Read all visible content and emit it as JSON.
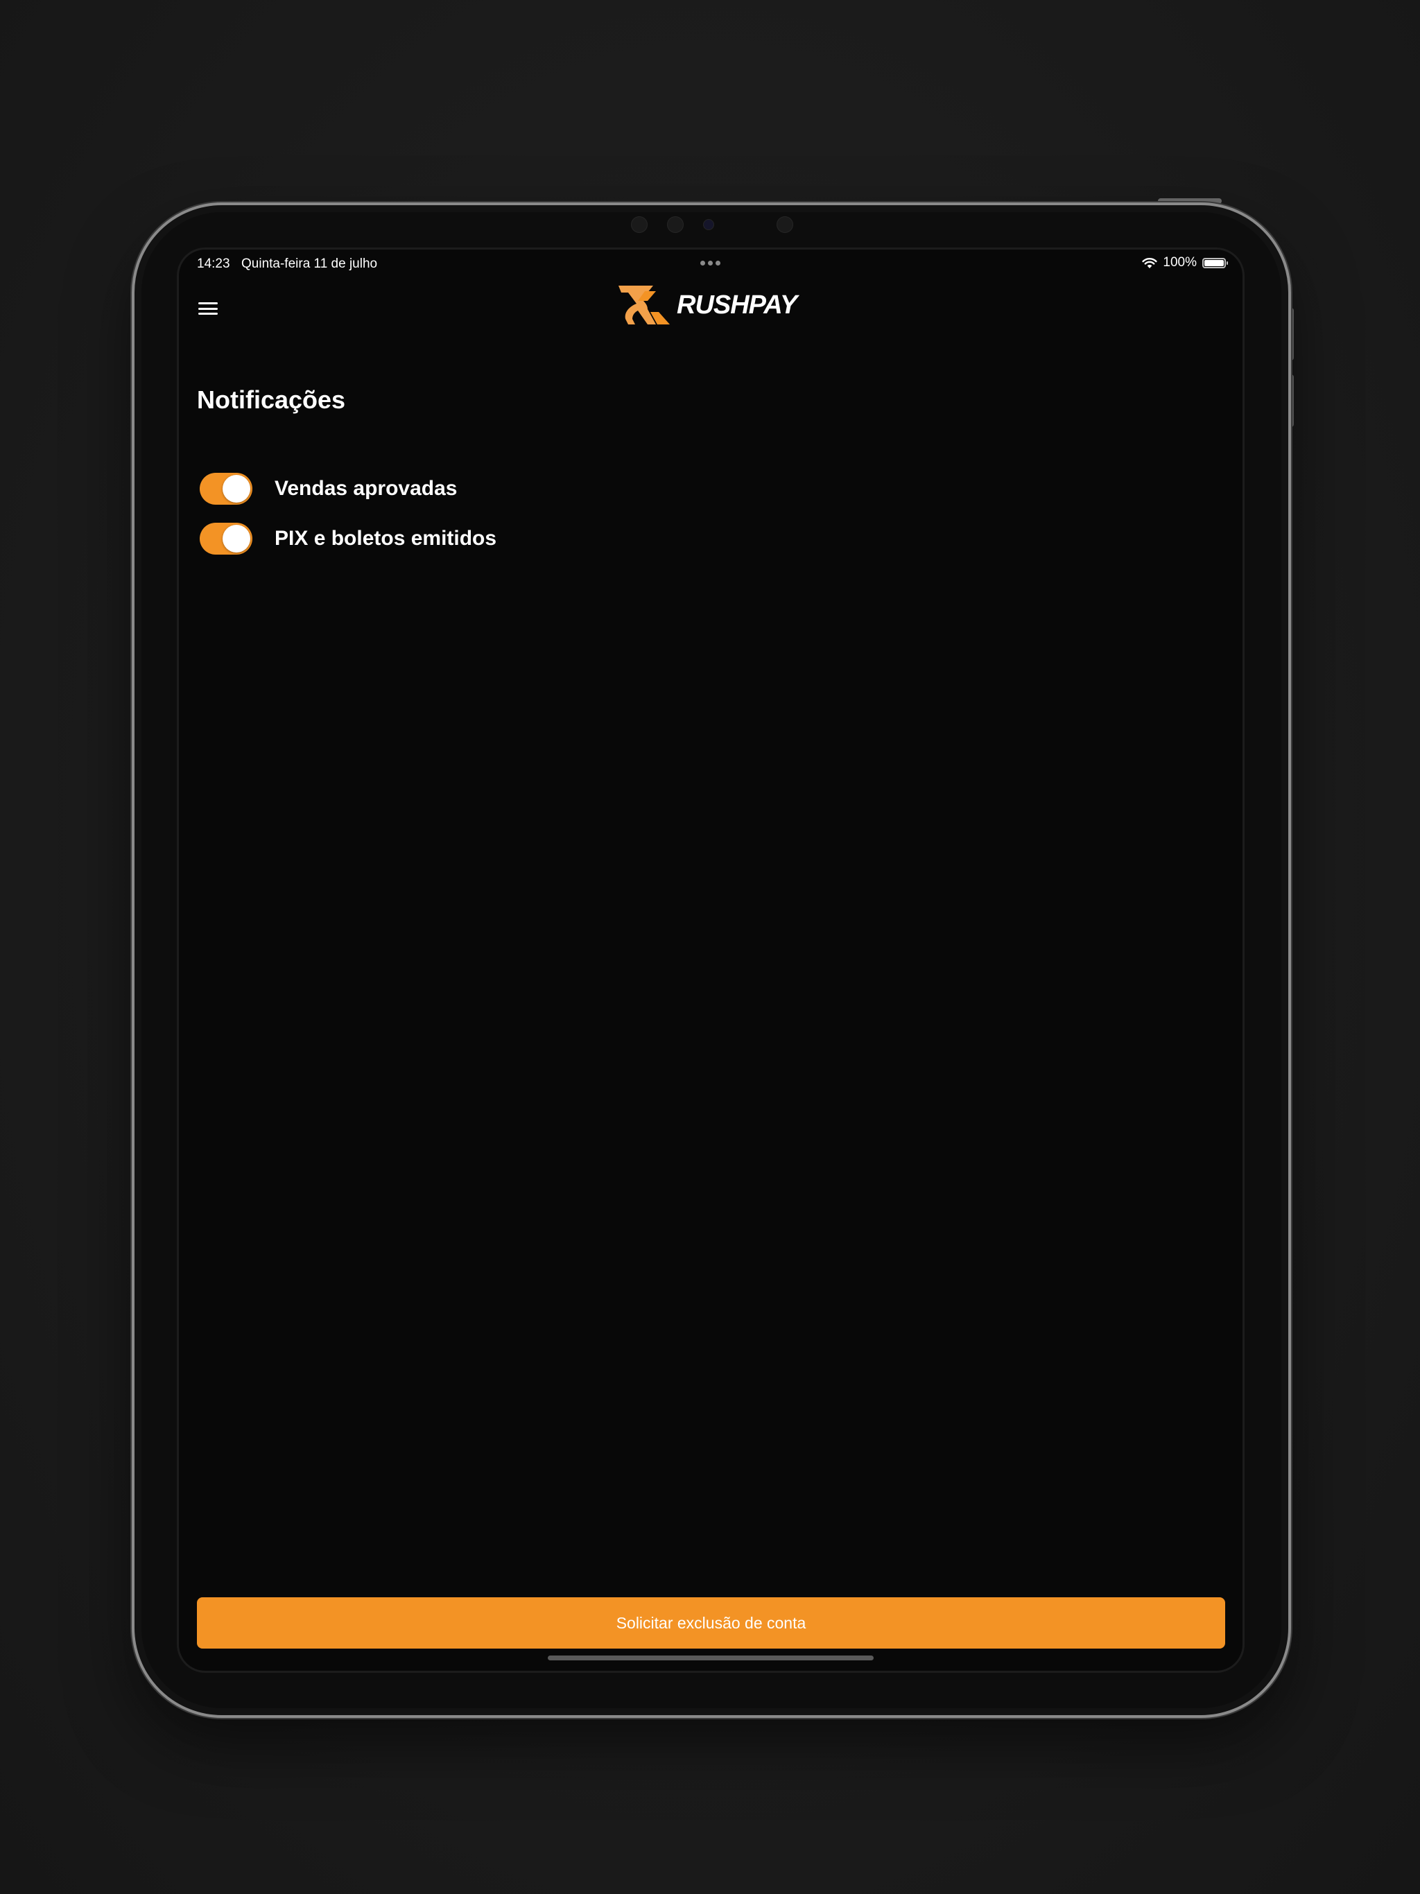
{
  "status_bar": {
    "time": "14:23",
    "date": "Quinta-feira 11 de julho",
    "battery": "100%"
  },
  "header": {
    "logo_text": "RUSHPAY",
    "menu_icon": "hamburger-menu-icon",
    "logo_icon": "rushpay-logo-icon"
  },
  "page": {
    "title": "Notificações"
  },
  "settings": {
    "items": [
      {
        "label": "Vendas aprovadas",
        "enabled": true
      },
      {
        "label": "PIX e boletos emitidos",
        "enabled": true
      }
    ]
  },
  "actions": {
    "delete_account_label": "Solicitar exclusão de conta"
  },
  "colors": {
    "accent": "#f39325",
    "background": "#080808",
    "text": "#ffffff"
  }
}
